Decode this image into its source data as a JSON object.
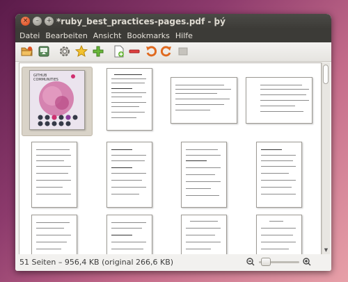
{
  "window": {
    "title": "*ruby_best_practices-pages.pdf - þý",
    "controls": {
      "close": "×",
      "minimize": "–",
      "maximize": "+"
    }
  },
  "menubar": {
    "items": [
      "Datei",
      "Bearbeiten",
      "Ansicht",
      "Bookmarks",
      "Hilfe"
    ]
  },
  "toolbar": {
    "icons": [
      "open-folder-icon",
      "export-icon",
      "gear-icon",
      "star-icon",
      "add-icon",
      "insert-page-icon",
      "delete-icon",
      "rotate-left-icon",
      "rotate-right-icon",
      "crop-icon"
    ]
  },
  "cover": {
    "title_line1": "GITHUB",
    "title_line2": "COMMUNITIES"
  },
  "pages": {
    "count": 12
  },
  "status": {
    "text": "51 Seiten – 956,4 KB (original 266,6 KB)"
  },
  "zoom": {
    "level": 0.12
  },
  "colors": {
    "accent": "#df4a16",
    "titlebar": "#3c3b37",
    "cover_bg": "#e8e2ec"
  }
}
